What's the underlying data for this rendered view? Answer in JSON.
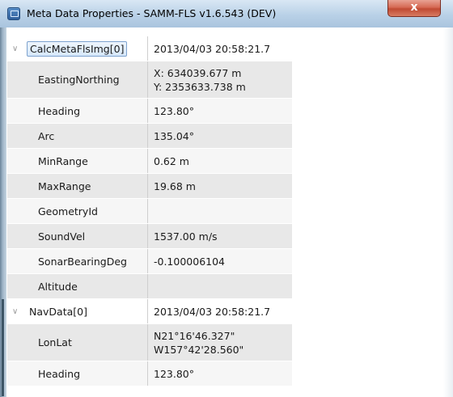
{
  "window": {
    "title": "Meta Data Properties - SAMM-FLS v1.6.543 (DEV)",
    "close_glyph": "x"
  },
  "groups": [
    {
      "name": "CalcMetaFlsImg[0]",
      "value": "2013/04/03 20:58:21.7",
      "expanded": true,
      "selected": true,
      "properties": [
        {
          "label": "EastingNorthing",
          "lines": [
            "X: 634039.677 m",
            "Y: 2353633.738 m"
          ]
        },
        {
          "label": "Heading",
          "lines": [
            "123.80°"
          ]
        },
        {
          "label": "Arc",
          "lines": [
            "135.04°"
          ]
        },
        {
          "label": "MinRange",
          "lines": [
            "0.62 m"
          ]
        },
        {
          "label": "MaxRange",
          "lines": [
            "19.68 m"
          ]
        },
        {
          "label": "GeometryId",
          "lines": [
            ""
          ]
        },
        {
          "label": "SoundVel",
          "lines": [
            "1537.00 m/s"
          ]
        },
        {
          "label": "SonarBearingDeg",
          "lines": [
            "-0.100006104"
          ]
        },
        {
          "label": "Altitude",
          "lines": [
            ""
          ]
        }
      ]
    },
    {
      "name": "NavData[0]",
      "value": "2013/04/03 20:58:21.7",
      "expanded": true,
      "selected": false,
      "properties": [
        {
          "label": "LonLat",
          "lines": [
            "N21°16'46.327\"",
            "W157°42'28.560\""
          ]
        },
        {
          "label": "Heading",
          "lines": [
            "123.80°"
          ]
        }
      ]
    }
  ]
}
